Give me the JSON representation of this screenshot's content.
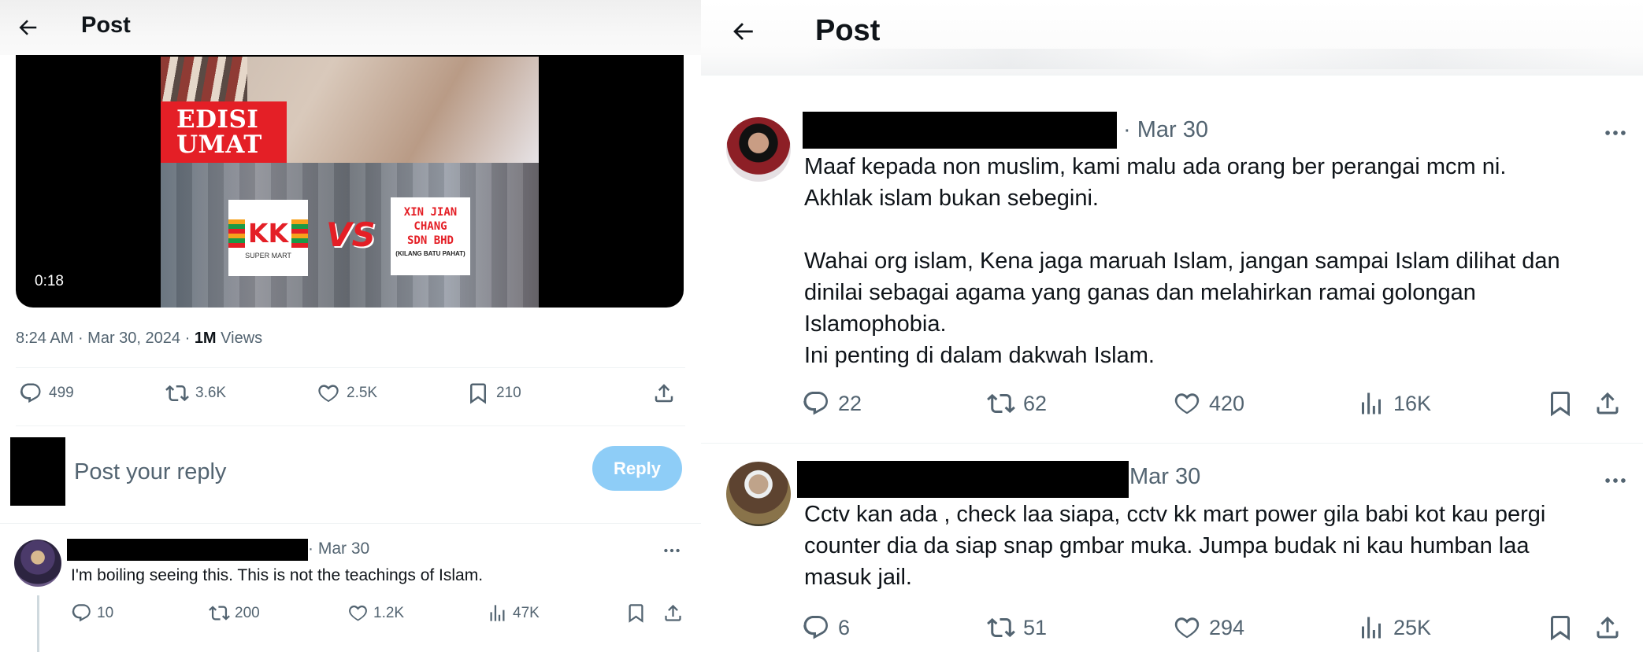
{
  "left": {
    "header": {
      "title": "Post"
    },
    "video": {
      "duration": "0:18",
      "overlay_text": [
        "EDISI",
        "UMAT"
      ],
      "kk_logo": "KK",
      "kk_sub": "SUPER MART",
      "vs": "VS",
      "xj_lines": [
        "XIN JIAN",
        "CHANG",
        "SDN BHD"
      ],
      "xj_sub": "(KILANG BATU PAHAT)"
    },
    "meta": {
      "time": "8:24 AM",
      "date": "Mar 30, 2024",
      "views_count": "1M",
      "views_label": "Views"
    },
    "actions": {
      "replies": "499",
      "reposts": "3.6K",
      "likes": "2.5K",
      "bookmarks": "210"
    },
    "reply_box": {
      "placeholder": "Post your reply",
      "button": "Reply"
    },
    "reply_tweet": {
      "date": "· Mar 30",
      "text": "I'm boiling seeing this. This is not the teachings of Islam.",
      "replies": "10",
      "reposts": "200",
      "likes": "1.2K",
      "views": "47K"
    }
  },
  "right": {
    "header": {
      "title": "Post"
    },
    "tweets": [
      {
        "date": "· Mar 30",
        "paragraphs": [
          "Maaf kepada non muslim, kami malu ada orang ber perangai mcm ni.",
          "Akhlak islam bukan sebegini.",
          "",
          "Wahai org islam, Kena jaga maruah Islam, jangan sampai Islam dilihat dan",
          "dinilai sebagai agama yang ganas dan melahirkan ramai golongan",
          "Islamophobia.",
          "Ini penting di dalam dakwah Islam."
        ],
        "replies": "22",
        "reposts": "62",
        "likes": "420",
        "views": "16K"
      },
      {
        "date": "Mar 30",
        "paragraphs": [
          "Cctv kan ada , check laa siapa, cctv kk mart power gila babi kot kau pergi",
          "counter dia da siap snap gmbar muka. Jumpa budak ni kau humban laa",
          "masuk jail."
        ],
        "replies": "6",
        "reposts": "51",
        "likes": "294",
        "views": "25K"
      }
    ]
  },
  "colors": {
    "muted": "#536471",
    "text": "#0f1419",
    "reply_button": "#8ecdf7",
    "accent_red": "#e41f26"
  }
}
